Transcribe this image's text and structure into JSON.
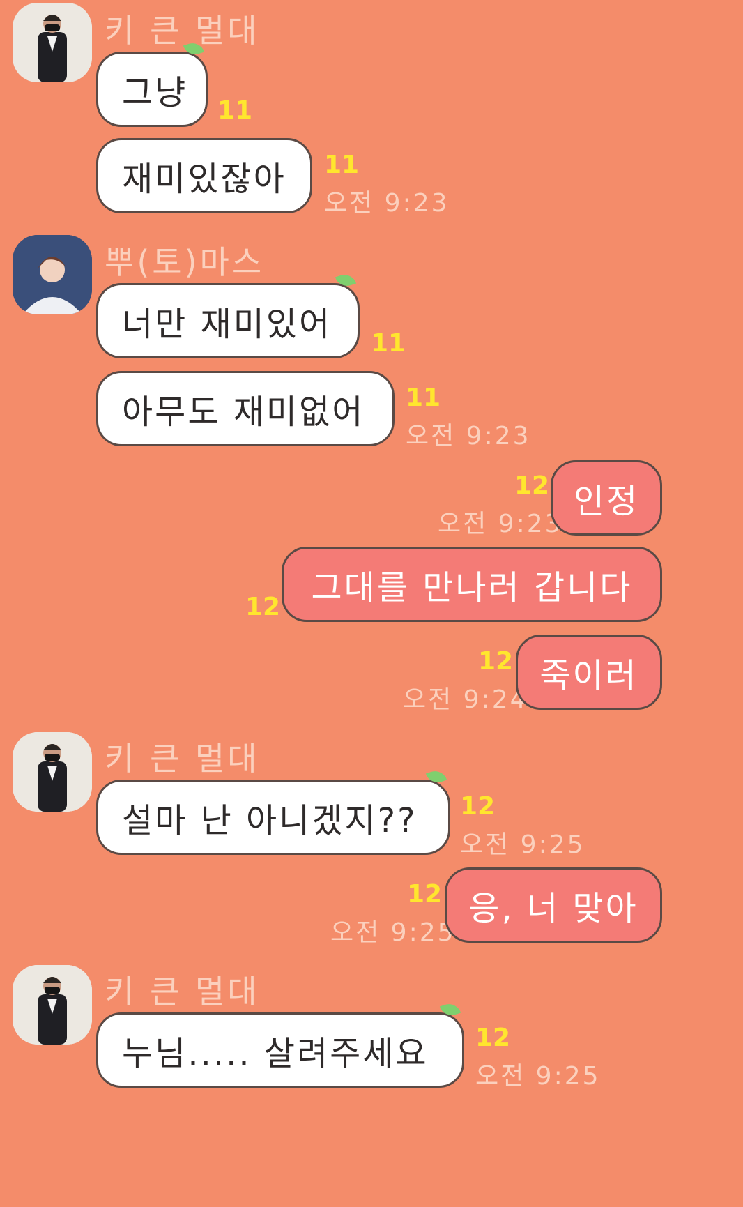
{
  "messages": [
    {
      "sender": "키 큰 멀대",
      "text": "그냥",
      "count": "11"
    },
    {
      "text": "재미있잖아",
      "count": "11",
      "time": "오전 9:23"
    },
    {
      "sender": "뿌(토)마스",
      "text": "너만 재미있어",
      "count": "11"
    },
    {
      "text": "아무도 재미없어",
      "count": "11",
      "time": "오전 9:23"
    },
    {
      "text": "인정",
      "count": "12",
      "time": "오전 9:23"
    },
    {
      "text": "그대를 만나러 갑니다",
      "count": "12"
    },
    {
      "text": "죽이러",
      "count": "12",
      "time": "오전 9:24"
    },
    {
      "sender": "키 큰 멀대",
      "text": "설마 난 아니겠지??",
      "count": "12",
      "time": "오전 9:25"
    },
    {
      "text": "응, 너 맞아",
      "count": "12",
      "time": "오전 9:25"
    },
    {
      "sender": "키 큰 멀대",
      "text": "누님..... 살려주세요",
      "count": "12",
      "time": "오전 9:25"
    }
  ],
  "icons": {
    "avatar": "profile-photo",
    "leaf": "leaf-icon"
  },
  "colors": {
    "background": "#f48c6a",
    "incoming_bubble": "#ffffff",
    "outgoing_bubble": "#f47b76",
    "unread_count": "#ffe62e",
    "timestamp": "#fbd0bd",
    "leaf": "#7fcf6e"
  }
}
